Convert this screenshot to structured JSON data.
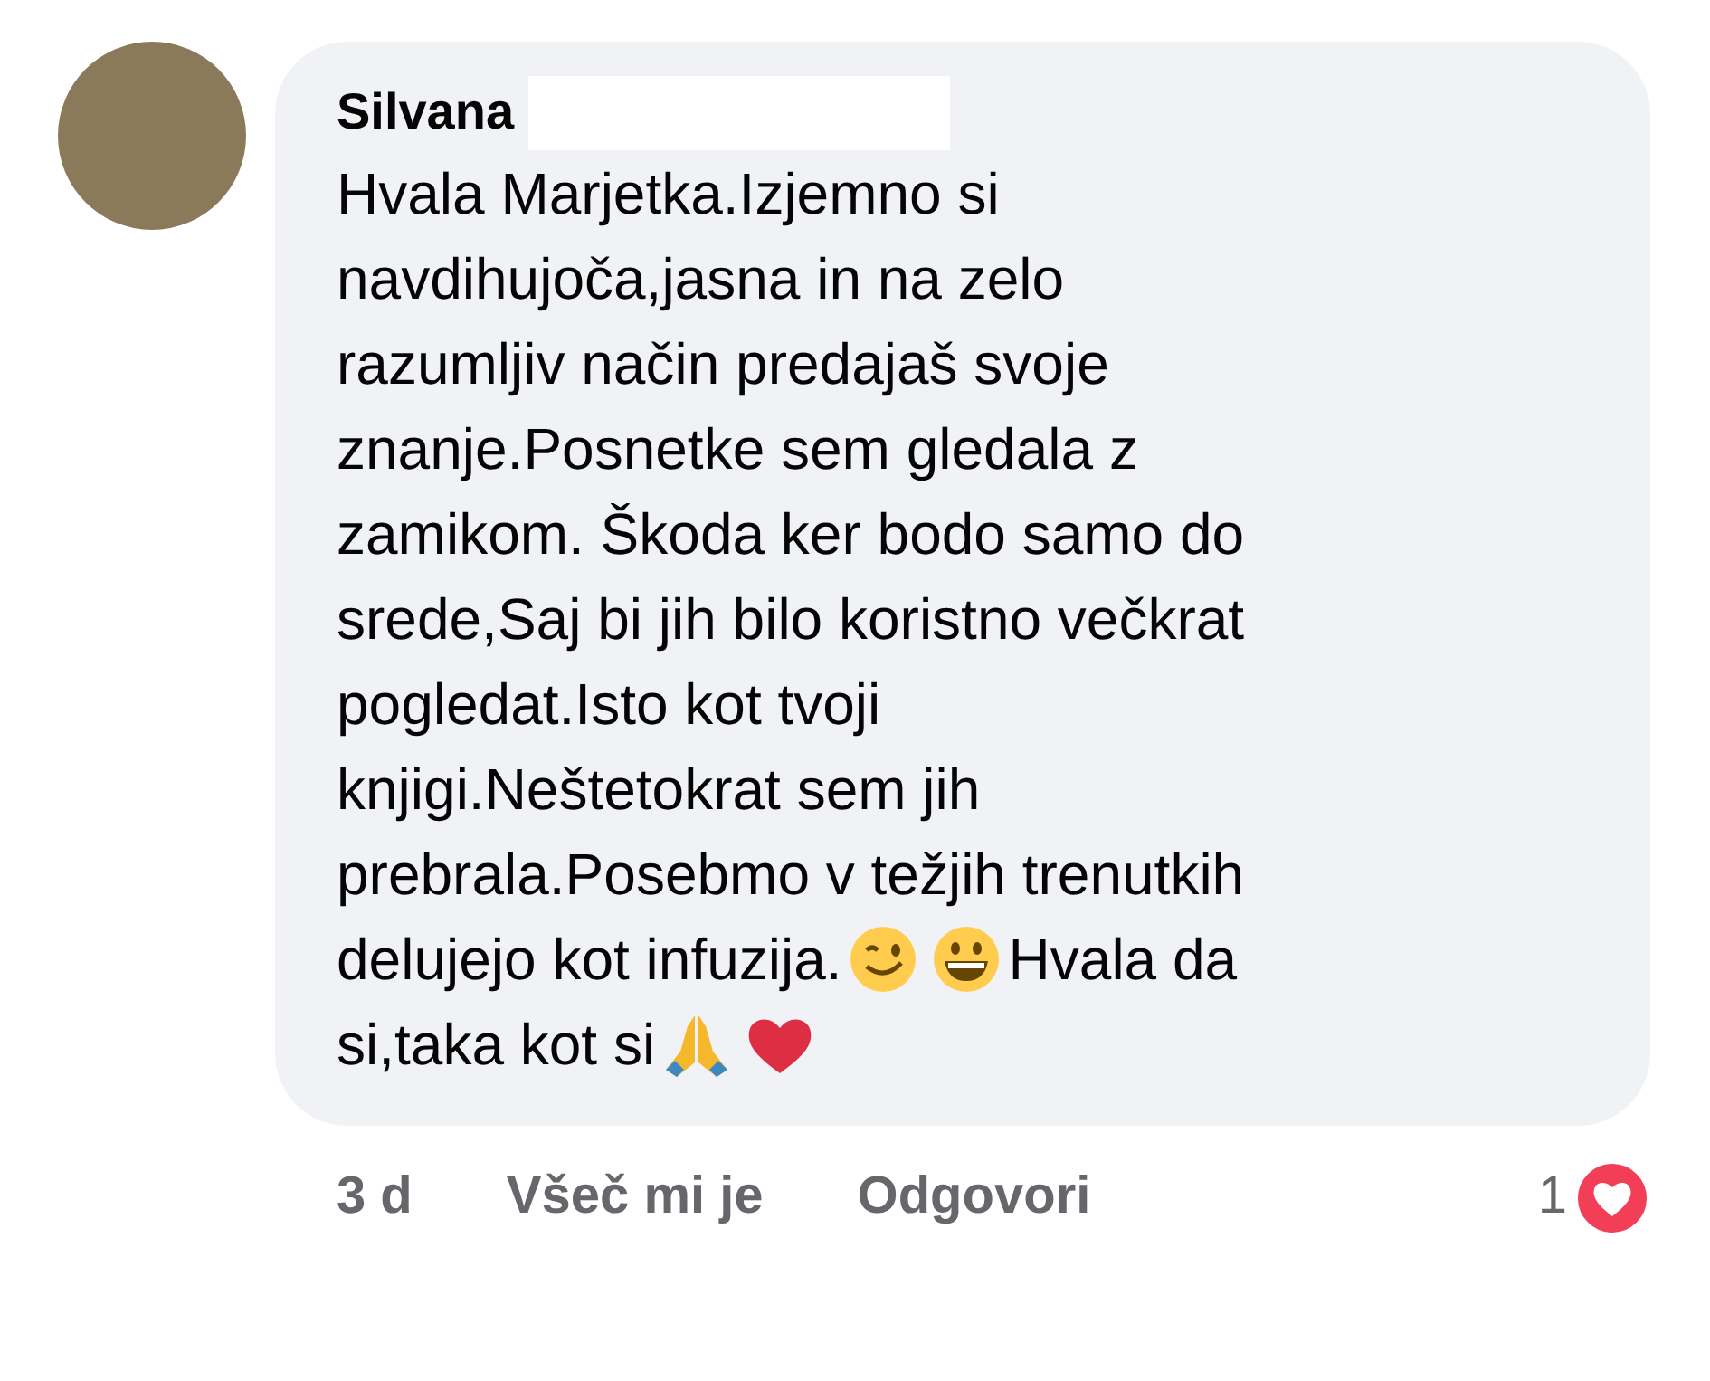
{
  "comment": {
    "author": "Silvana",
    "lines": [
      [
        {
          "kind": "text",
          "text": "Hvala Marjetka.Izjemno si"
        }
      ],
      [
        {
          "kind": "text",
          "text": "navdihujoča,jasna in na zelo"
        }
      ],
      [
        {
          "kind": "text",
          "text": "razumljiv način predajaš svoje"
        }
      ],
      [
        {
          "kind": "text",
          "text": "znanje.Posnetke sem gledala z"
        }
      ],
      [
        {
          "kind": "text",
          "text": "zamikom. Škoda ker bodo samo do"
        }
      ],
      [
        {
          "kind": "text",
          "text": "srede,Saj bi jih bilo koristno večkrat"
        }
      ],
      [
        {
          "kind": "text",
          "text": "pogledat.Isto kot tvoji"
        }
      ],
      [
        {
          "kind": "text",
          "text": "knjigi.Neštetokrat sem jih"
        }
      ],
      [
        {
          "kind": "text",
          "text": "prebrala.Posebmo v težjih trenutkih"
        }
      ],
      [
        {
          "kind": "text",
          "text": "delujejo kot infuzija."
        },
        {
          "kind": "wink"
        },
        {
          "kind": "grin"
        },
        {
          "kind": "text",
          "text": "Hvala da"
        }
      ],
      [
        {
          "kind": "text",
          "text": "si,taka kot si"
        },
        {
          "kind": "pray"
        },
        {
          "kind": "heart"
        }
      ]
    ]
  },
  "actions": {
    "time": "3 d",
    "like": "Všeč mi je",
    "reply": "Odgovori",
    "reaction_count": "1"
  }
}
